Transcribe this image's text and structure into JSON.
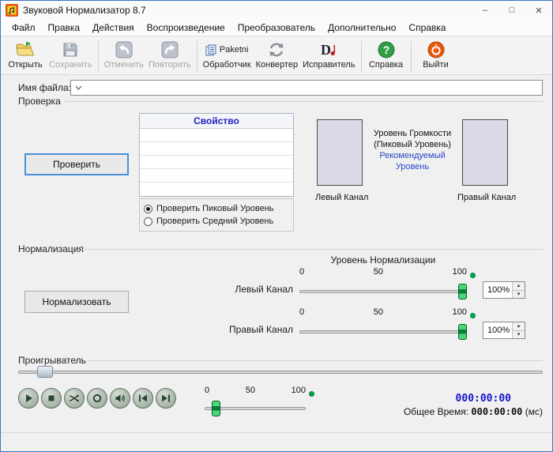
{
  "window": {
    "title": "Звуковой Нормализатор 8.7"
  },
  "icons": {
    "minimize": "–",
    "maximize": "□",
    "close": "✕",
    "spin_up": "▴",
    "spin_down": "▾"
  },
  "colors": {
    "accent_focus": "#4a90d9",
    "link_blue": "#2a48c8",
    "time_blue": "#1414cc",
    "handle_green": "#2ecc60",
    "indicator_green": "#00a84e",
    "meter_fill": "#dadae6"
  },
  "menu": {
    "items": [
      {
        "label": "Файл"
      },
      {
        "label": "Правка"
      },
      {
        "label": "Действия"
      },
      {
        "label": "Воспроизведение"
      },
      {
        "label": "Преобразователь"
      },
      {
        "label": "Дополнительно"
      },
      {
        "label": "Справка"
      }
    ]
  },
  "toolbar": {
    "open": "Открыть",
    "save": "Сохранить",
    "undo": "Отменить",
    "redo": "Повторить",
    "batch_line1": "Paketni",
    "batch_line2": "Обработчик",
    "converter": "Конвертер",
    "fixer": "Исправитель",
    "help": "Справка",
    "exit": "Выйти"
  },
  "file_row": {
    "label": "Имя файла:"
  },
  "check": {
    "title": "Проверка",
    "button": "Проверить",
    "table_header": "Свойство",
    "radio_peak": "Проверить Пиковый Уровень",
    "radio_mid": "Проверить Средний Уровень",
    "left_label": "Левый Канал",
    "right_label": "Правый Канал",
    "volume_line1": "Уровень Громкости",
    "volume_line2": "(Пиковый Уровень)",
    "recommended_line1": "Рекомендуемый",
    "recommended_line2": "Уровень"
  },
  "normalize": {
    "title": "Нормализация",
    "button": "Нормализовать",
    "header": "Уровень Нормализации",
    "left_label": "Левый Канал",
    "right_label": "Правый Канал",
    "ticks": [
      "0",
      "50",
      "100"
    ],
    "left_value": "100%",
    "right_value": "100%"
  },
  "player": {
    "title": "Проигрыватель",
    "ticks": [
      "0",
      "50",
      "100"
    ],
    "elapsed": "000:00:00",
    "total_label": "Общее Время:",
    "total_value": "000:00:00",
    "total_unit": "(мс)"
  }
}
